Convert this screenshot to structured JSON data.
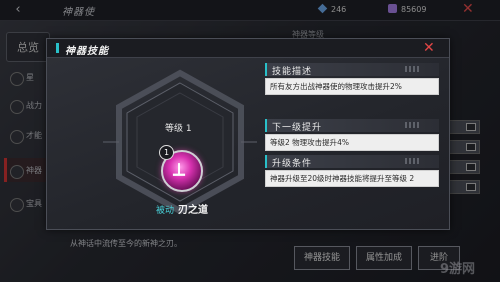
{
  "topbar": {
    "back_icon": "back-arrow-icon",
    "title": "神器使",
    "resource1": {
      "icon": "diamond-icon",
      "value": "246"
    },
    "resource2": {
      "icon": "crystal-icon",
      "value": "85609"
    },
    "close_icon": "close-icon"
  },
  "left_menu": {
    "overview_tab": "总览",
    "items": [
      {
        "label": "星",
        "icon": "star-icon"
      },
      {
        "label": "战力",
        "icon": "sword-icon"
      },
      {
        "label": "才能",
        "icon": "talent-icon"
      },
      {
        "label": "神器",
        "icon": "artifact-icon"
      },
      {
        "label": "宝具",
        "icon": "treasure-icon"
      }
    ]
  },
  "background": {
    "right_title": "神器等级",
    "description": "从神话中流传至今的新神之刃。"
  },
  "bottom_buttons": [
    "神器技能",
    "属性加成",
    "进阶"
  ],
  "watermark": "9游网",
  "modal": {
    "title": "神器技能",
    "close_icon": "close-icon",
    "level_label": "等级 1",
    "skill_badge": "1",
    "skill_type": "被动",
    "skill_name": "刃之道",
    "sections": [
      {
        "key": "desc",
        "label": "技能描述",
        "text": "所有友方出战神器使的物理攻击提升2%"
      },
      {
        "key": "next",
        "label": "下一级提升",
        "text": "等级2 物理攻击提升4%"
      },
      {
        "key": "cond",
        "label": "升级条件",
        "text": "神器升级至20级时神器技能将提升至等级 2"
      }
    ]
  },
  "colors": {
    "accent": "#29c0c9",
    "close": "#e24646",
    "skill_magenta": "#d832b0"
  }
}
